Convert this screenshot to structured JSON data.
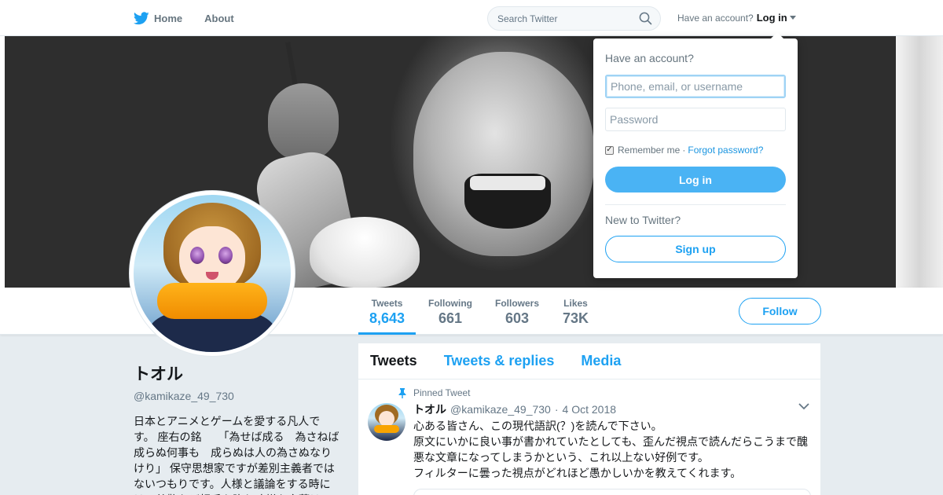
{
  "nav": {
    "home_label": "Home",
    "about_label": "About",
    "search_placeholder": "Search Twitter",
    "account_prompt": "Have an account?",
    "login_label": "Log in"
  },
  "profile": {
    "name": "トオル",
    "handle": "@kamikaze_49_730",
    "bio": "日本とアニメとゲームを愛する凡人です。 座右の銘　　「為せば成る　為さねば成らぬ何事も　成らぬは人の為さぬなりけり」 保守思想家ですが差別主義者ではないつもりです。人様と議論をする時には、尊敬など相手を陥れ才様な言葉は",
    "follow_label": "Follow"
  },
  "stats": [
    {
      "label": "Tweets",
      "value": "8,643"
    },
    {
      "label": "Following",
      "value": "661"
    },
    {
      "label": "Followers",
      "value": "603"
    },
    {
      "label": "Likes",
      "value": "73K"
    }
  ],
  "timeline": {
    "tabs": [
      "Tweets",
      "Tweets & replies",
      "Media"
    ],
    "pinned_label": "Pinned Tweet",
    "tweet": {
      "name": "トオル",
      "handle": "@kamikaze_49_730",
      "separator": "·",
      "date": "4 Oct 2018",
      "lines": [
        "心ある皆さん、この現代語訳(？)を読んで下さい。",
        "原文にいかに良い事が書かれていたとしても、歪んだ視点で読んだらこうまで醜",
        "悪な文章になってしまうかという、これ以上ない好例です。",
        "フィルターに曇った視点がどれほど愚かしいかを教えてくれます。"
      ]
    }
  },
  "login_dropdown": {
    "title": "Have an account?",
    "username_placeholder": "Phone, email, or username",
    "password_placeholder": "Password",
    "remember_label": "Remember me",
    "separator": "·",
    "forgot_label": "Forgot password?",
    "login_button": "Log in",
    "new_prompt": "New to Twitter?",
    "signup_button": "Sign up"
  },
  "colors": {
    "accent": "#1da1f2",
    "login_button_bg": "#4ab3f4",
    "background": "#e6ecf0"
  },
  "icons": [
    "twitter-bird-icon",
    "search-icon",
    "caret-down-icon",
    "pin-icon",
    "chevron-down-icon",
    "checkbox-checked-icon"
  ]
}
